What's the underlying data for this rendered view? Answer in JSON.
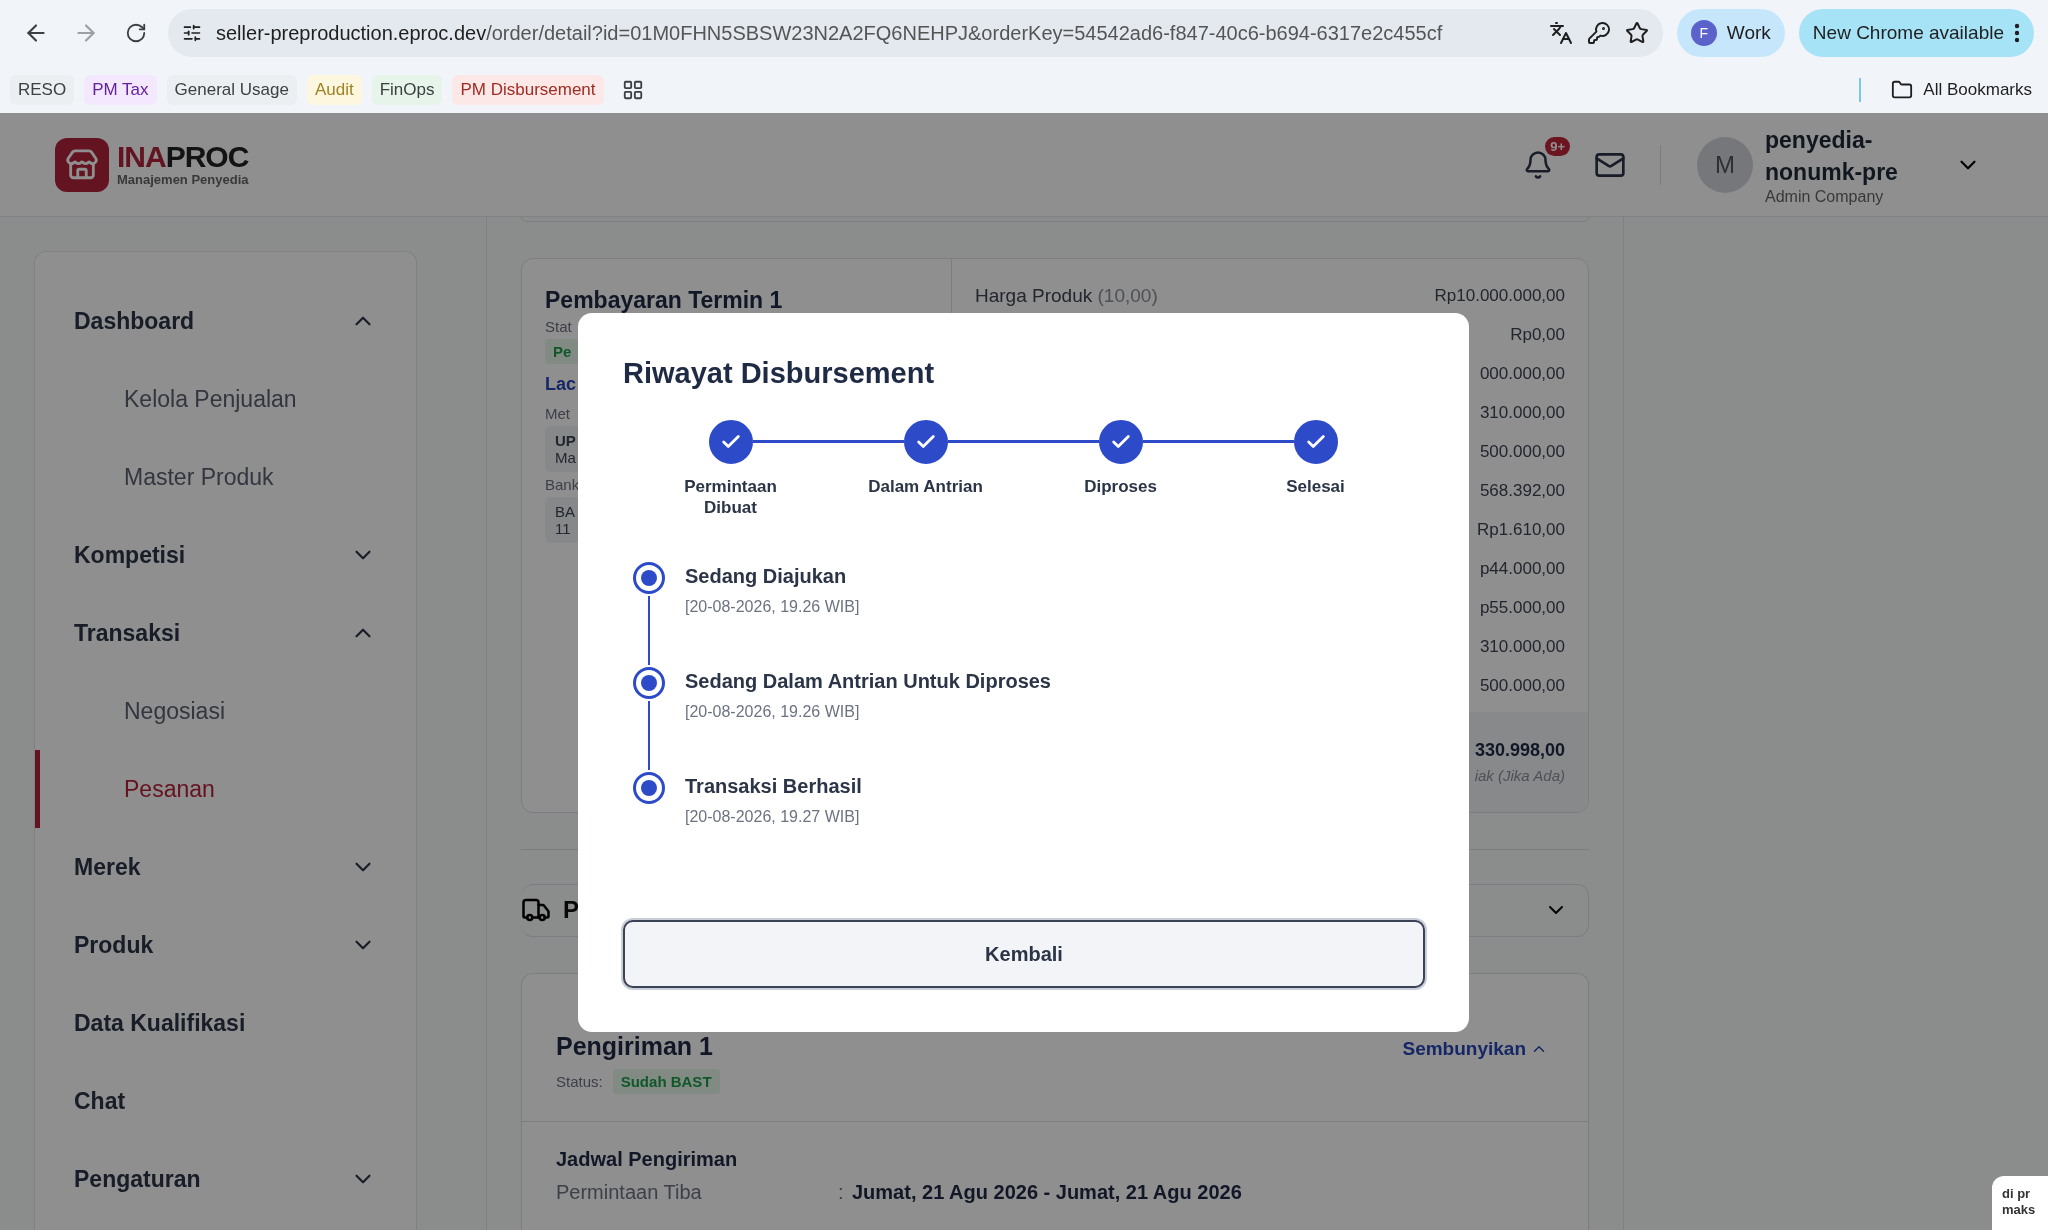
{
  "browser": {
    "url_host": "seller-preproduction.eproc.dev",
    "url_path": "/order/detail?id=01M0FHN5SBSW23N2A2FQ6NEHPJ&orderKey=54542ad6-f847-40c6-b694-6317e2c455cf",
    "profile": {
      "initial": "F",
      "label": "Work"
    },
    "update_button": "New Chrome available",
    "bookmarks": [
      {
        "label": "RESO",
        "color": "#eceff1"
      },
      {
        "label": "PM Tax",
        "color": "#f3e8fd"
      },
      {
        "label": "General Usage",
        "color": "#eceff1"
      },
      {
        "label": "Audit",
        "color": "#fef7e0"
      },
      {
        "label": "FinOps",
        "color": "#e6f4ea"
      },
      {
        "label": "PM Disbursement",
        "color": "#fce8e6"
      }
    ],
    "all_bookmarks": "All Bookmarks"
  },
  "header": {
    "logo": {
      "brand_a": "INA",
      "brand_b": "PROC",
      "subtitle": "Manajemen Penyedia"
    },
    "notification_badge": "9+",
    "user": {
      "initial": "M",
      "name": "penyedia-nonumk-pre",
      "role": "Admin Company"
    }
  },
  "sidebar": {
    "items": [
      {
        "label": "Dashboard",
        "kind": "group",
        "expanded": true,
        "selected": false,
        "children": [
          {
            "label": "Kelola Penjualan",
            "selected": false
          },
          {
            "label": "Master Produk",
            "selected": false
          }
        ]
      },
      {
        "label": "Kompetisi",
        "kind": "group",
        "expanded": false,
        "selected": false
      },
      {
        "label": "Transaksi",
        "kind": "group",
        "expanded": true,
        "selected": false,
        "children": [
          {
            "label": "Negosiasi",
            "selected": false
          },
          {
            "label": "Pesanan",
            "selected": true
          }
        ]
      },
      {
        "label": "Merek",
        "kind": "group",
        "expanded": false,
        "selected": false
      },
      {
        "label": "Produk",
        "kind": "group",
        "expanded": false,
        "selected": false
      },
      {
        "label": "Data Kualifikasi",
        "kind": "link",
        "selected": false
      },
      {
        "label": "Chat",
        "kind": "link",
        "selected": false
      },
      {
        "label": "Pengaturan",
        "kind": "group",
        "expanded": false,
        "selected": false
      }
    ]
  },
  "payment": {
    "title": "Pembayaran Termin 1",
    "status_label": "Stat",
    "status_badge": "Pe",
    "link": "Lac",
    "method_label": "Met",
    "method_box": [
      "UP",
      "Ma"
    ],
    "bank_label": "Bank",
    "bank_box": [
      "BA",
      "11"
    ],
    "rows": [
      {
        "label": "Harga Produk",
        "note": "(10,00)",
        "amount": "Rp10.000.000,00"
      },
      {
        "amount": "Rp0,00"
      },
      {
        "amount": "000.000,00"
      },
      {
        "amount": "310.000,00"
      },
      {
        "amount": "500.000,00"
      },
      {
        "amount": "568.392,00"
      },
      {
        "amount": "Rp1.610,00"
      },
      {
        "amount": "p44.000,00"
      },
      {
        "amount": "p55.000,00"
      },
      {
        "amount": "310.000,00"
      },
      {
        "amount": "500.000,00"
      }
    ],
    "total": "330.998,00",
    "total_note": "iak (Jika Ada)"
  },
  "shipping": {
    "section_title": "P",
    "shipment": {
      "title": "Pengiriman 1",
      "status_label": "Status:",
      "status": "Sudah BAST",
      "toggle": "Sembunyikan",
      "schedule_title": "Jadwal Pengiriman",
      "fields": [
        {
          "label": "Permintaan Tiba",
          "separator": ":",
          "value": "Jumat, 21 Agu 2026 - Jumat, 21 Agu 2026"
        }
      ]
    }
  },
  "modal": {
    "title": "Riwayat Disbursement",
    "steps": [
      {
        "label": "Permintaan Dibuat",
        "done": true
      },
      {
        "label": "Dalam Antrian",
        "done": true
      },
      {
        "label": "Diproses",
        "done": true
      },
      {
        "label": "Selesai",
        "done": true
      }
    ],
    "history": [
      {
        "title": "Sedang Diajukan",
        "time": "[20-08-2026, 19.26 WIB]"
      },
      {
        "title": "Sedang Dalam Antrian Untuk Diproses",
        "time": "[20-08-2026, 19.26 WIB]"
      },
      {
        "title": "Transaksi Berhasil",
        "time": "[20-08-2026, 19.27 WIB]"
      }
    ],
    "button": "Kembali"
  },
  "chat_widget": {
    "lines": [
      "di pr",
      "maks"
    ]
  }
}
